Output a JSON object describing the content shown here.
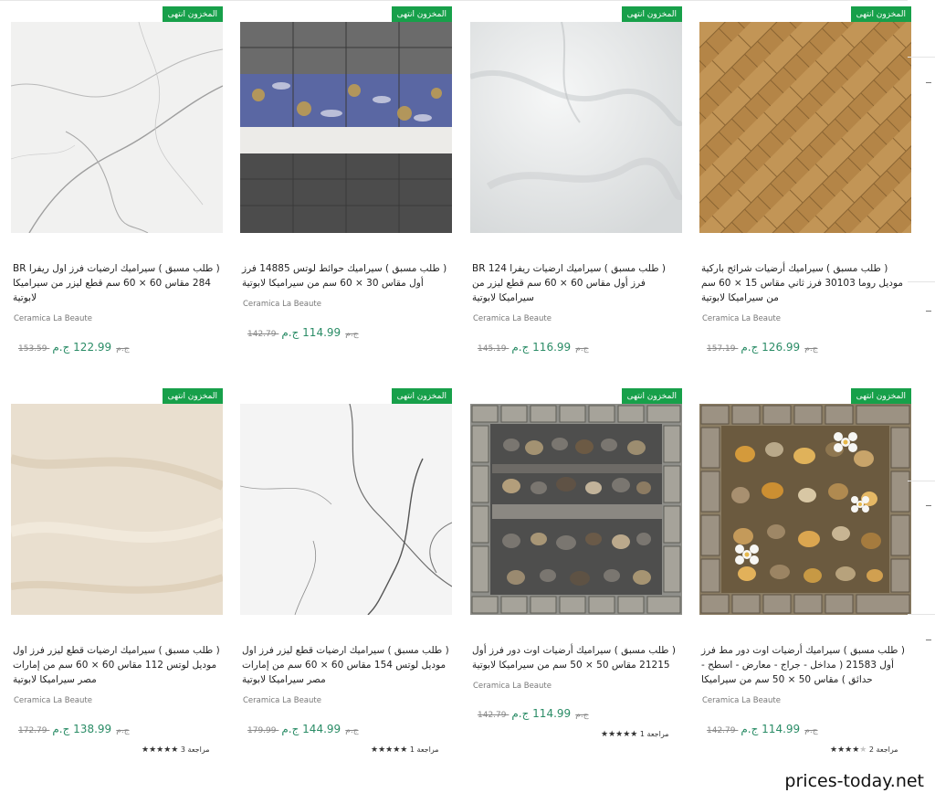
{
  "badge_text": "المخزون انتهى",
  "products": [
    {
      "title": "( طلب مسبق ) سيراميك ارضيات فرز اول ريفرا BR 284 مقاس 60 × 60 سم قطع ليزر من سيراميكا لابوتية",
      "brand": "Ceramica La Beaute",
      "old_price": "153.59 ج.م",
      "new_price": "122.99 ج.م",
      "reviews": "",
      "rating": 0,
      "image": "white-marble-tile"
    },
    {
      "title": "( طلب مسبق ) سيراميك حوائط لوتس 14885 فرز أول مقاس 30 × 60 سم من سيراميكا لابوتية",
      "brand": "Ceramica La Beaute",
      "old_price": "142.79 ج.م",
      "new_price": "114.99 ج.م",
      "reviews": "",
      "rating": 0,
      "image": "floral-wall-tiles"
    },
    {
      "title": "( طلب مسبق ) سيراميك ارضيات ريفرا BR 124 فرز أول مقاس 60 × 60 سم قطع ليزر من سيراميكا لابوتية",
      "brand": "Ceramica La Beaute",
      "old_price": "145.19 ج.م",
      "new_price": "116.99 ج.م",
      "reviews": "",
      "rating": 0,
      "image": "light-onyx-tile"
    },
    {
      "title": "( طلب مسبق ) سيراميك أرضيات شرائح باركية موديل روما 30103 فرز ثاني مقاس 15 × 60 سم من سيراميكا لابوتية",
      "brand": "Ceramica La Beaute",
      "old_price": "157.19 ج.م",
      "new_price": "126.99 ج.م",
      "reviews": "",
      "rating": 0,
      "image": "herringbone-wood"
    },
    {
      "title": "( طلب مسبق ) سيراميك ارضيات قطع ليزر فرز اول موديل لوتس 112 مقاس 60 × 60 سم من إمارات مصر سيراميكا لابوتية",
      "brand": "Ceramica La Beaute",
      "old_price": "172.79 ج.م",
      "new_price": "138.99 ج.م",
      "reviews": "3 مراجعة",
      "rating": 5,
      "image": "cream-marble-tile"
    },
    {
      "title": "( طلب مسبق ) سيراميك ارضيات قطع ليزر فرز اول موديل لوتس 154 مقاس 60 × 60 سم من إمارات مصر سيراميكا لابوتية",
      "brand": "Ceramica La Beaute",
      "old_price": "179.99 ج.م",
      "new_price": "144.99 ج.م",
      "reviews": "1 مراجعة",
      "rating": 5,
      "image": "white-veined-marble"
    },
    {
      "title": "( طلب مسبق ) سيراميك أرضيات اوت دور فرز أول 21215 مقاس 50 × 50 سم من سيراميكا لابوتية",
      "brand": "Ceramica La Beaute",
      "old_price": "142.79 ج.م",
      "new_price": "114.99 ج.م",
      "reviews": "1 مراجعة",
      "rating": 5,
      "image": "pebble-stone-tile"
    },
    {
      "title": "( طلب مسبق ) سيراميك أرضيات اوت دور مط فرز أول 21583 ( مداخل - جراج - معارض - اسطح - حدائق ) مقاس 50 × 50 سم من سيراميكا",
      "brand": "Ceramica La Beaute",
      "old_price": "142.79 ج.م",
      "new_price": "114.99 ج.م",
      "reviews": "2 مراجعة",
      "rating": 4,
      "image": "flower-pebble-tile"
    }
  ],
  "watermark": "prices-today.net",
  "colors": {
    "badge": "#17a04a",
    "price": "#2a8c66"
  }
}
